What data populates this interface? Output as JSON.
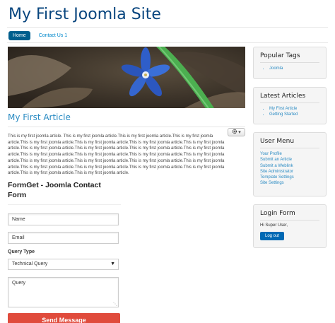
{
  "site": {
    "title": "My First Joomla Site"
  },
  "nav": {
    "items": [
      {
        "label": "Home"
      },
      {
        "label": "Contact Us 1"
      }
    ]
  },
  "article": {
    "title": "My First Article",
    "tools_icon": "gear-icon",
    "tools_caret": "▾",
    "text": "This is my first joomla article. This is my first joomla article.This is my first joomla article.This is my first joomla article.This is my first joomla article.This is my first joomla article.This is my first joomla article.This is my first joomla article.This is my first joomla article.This is my first joomla article.This is my first joomla article.This is my first joomla article.This is my first joomla article.This is my first joomla article.This is my first joomla article.This is my first joomla article.This is my first joomla article.This is my first joomla article.This is my first joomla article.This is my first joomla article.This is my first joomla article.This is my first joomla article.This is my first joomla article.This is my first joomla article.This is my first joomla article.This is my first joomla article."
  },
  "contact_form": {
    "title": "FormGet - Joomla Contact Form",
    "name_placeholder": "Name",
    "email_placeholder": "Email",
    "query_type_label": "Query Type",
    "query_type_selected": "Technical Query",
    "query_placeholder": "Query",
    "send_label": "Send Message"
  },
  "sidebar": {
    "popular_tags": {
      "title": "Popular Tags",
      "items": [
        "Joomla"
      ]
    },
    "latest_articles": {
      "title": "Latest Articles",
      "items": [
        "My First Article",
        "Getting Started"
      ]
    },
    "user_menu": {
      "title": "User Menu",
      "items": [
        "Your Profile",
        "Submit an Article",
        "Submit a Weblink",
        "Site Administrator",
        "Template Settings",
        "Site Settings"
      ]
    },
    "login_form": {
      "title": "Login Form",
      "greeting": "Hi Super User,",
      "logout_label": "Log out"
    }
  },
  "colors": {
    "link": "#2a8bc3",
    "nav_active": "#005e8d",
    "send_button": "#e04b3c",
    "logout_button": "#0069b4"
  }
}
